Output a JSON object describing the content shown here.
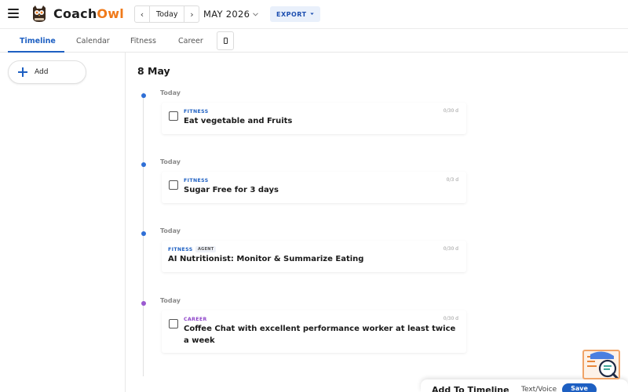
{
  "header": {
    "brand_part1": "Coach",
    "brand_part2": "Owl",
    "prev_label": "‹",
    "next_label": "›",
    "today_label": "Today",
    "month_label": "MAY 2026",
    "export_label": "EXPORT"
  },
  "tabs": {
    "items": [
      {
        "label": "Timeline"
      },
      {
        "label": "Calendar"
      },
      {
        "label": "Fitness"
      },
      {
        "label": "Career"
      }
    ]
  },
  "sidebar": {
    "add_label": "Add"
  },
  "timeline": {
    "day_title": "8 May",
    "entries": [
      {
        "day_label": "Today",
        "category": "FITNESS",
        "progress": "0/30 d",
        "title": "Eat vegetable and Fruits"
      },
      {
        "day_label": "Today",
        "category": "FITNESS",
        "progress": "0/3 d",
        "title": "Sugar Free for 3 days"
      },
      {
        "day_label": "Today",
        "category": "FITNESS",
        "badge": "AGENT",
        "progress": "0/30 d",
        "title": "AI Nutritionist: Monitor & Summarize Eating"
      },
      {
        "day_label": "Today",
        "category": "CAREER",
        "progress": "0/30 d",
        "title_line1": "Coffee Chat with excellent performance worker at least twice",
        "title_line2": "a week"
      }
    ]
  },
  "bottom_panel": {
    "title": "Add To Timeline",
    "subtitle": "Text/Voice",
    "save_label": "Save"
  },
  "colors": {
    "accent": "#1d5fc2",
    "brand_orange": "#f07a1a",
    "career_purple": "#8e44c9"
  }
}
